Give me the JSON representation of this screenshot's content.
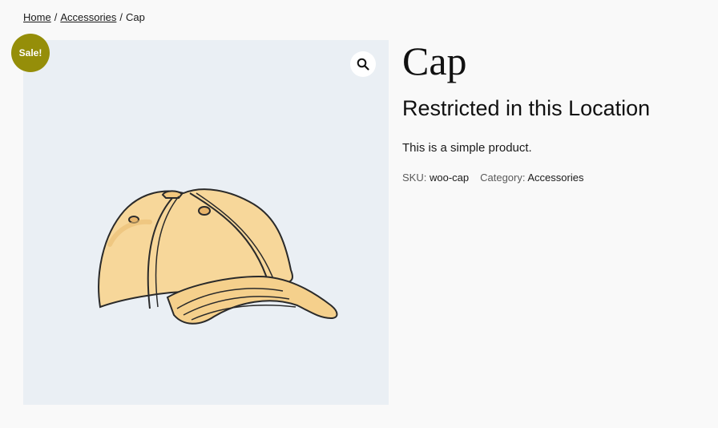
{
  "breadcrumb": {
    "home": "Home",
    "sep1": "/",
    "category": "Accessories",
    "sep2": "/",
    "current": "Cap"
  },
  "gallery": {
    "badge": "Sale!",
    "zoom_icon": "magnifier-icon",
    "image_alt": "Cap",
    "background_color": "#eaeff4",
    "badge_color": "#958e09"
  },
  "product": {
    "title": "Cap",
    "notice": "Restricted in this Location",
    "short_description": "This is a simple product.",
    "sku_label": "SKU:",
    "sku_value": "woo-cap",
    "category_label": "Category:",
    "category_value": "Accessories"
  }
}
